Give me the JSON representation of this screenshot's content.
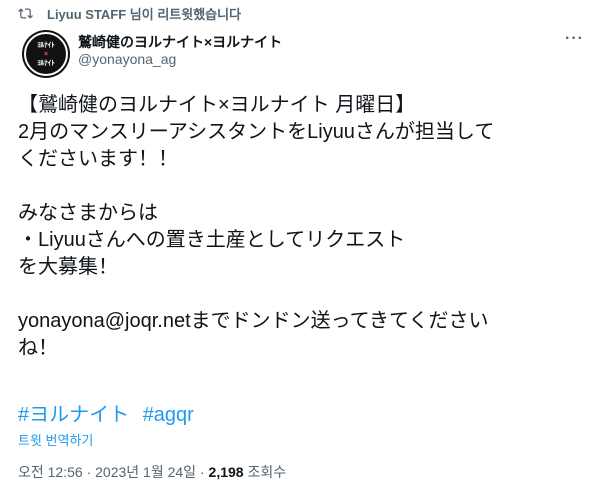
{
  "retweet": {
    "text": "Liyuu STAFF 님이 리트윗했습니다"
  },
  "author": {
    "name": "鷲崎健のヨルナイト×ヨルナイト",
    "handle": "@yonayona_ag"
  },
  "tweet": {
    "lines": [
      "【鷲崎健のヨルナイト×ヨルナイト 月曜日】",
      "2月のマンスリーアシスタントをLiyuuさんが担当して",
      "くださいます！！",
      "",
      "みなさまからは",
      "・Liyuuさんへの置き土産としてリクエスト",
      "を大募集！",
      "",
      "yonayona@joqr.netまでドンドン送ってきてください",
      "ね！"
    ],
    "hashtags": [
      "#ヨルナイト",
      "#agqr"
    ],
    "translate_label": "트윗 번역하기"
  },
  "meta": {
    "time": "오전 12:56",
    "date": "2023년 1월 24일",
    "views_count": "2,198",
    "views_label": "조회수"
  },
  "icons": {
    "retweet": "retweet-icon",
    "more": "more-icon"
  }
}
